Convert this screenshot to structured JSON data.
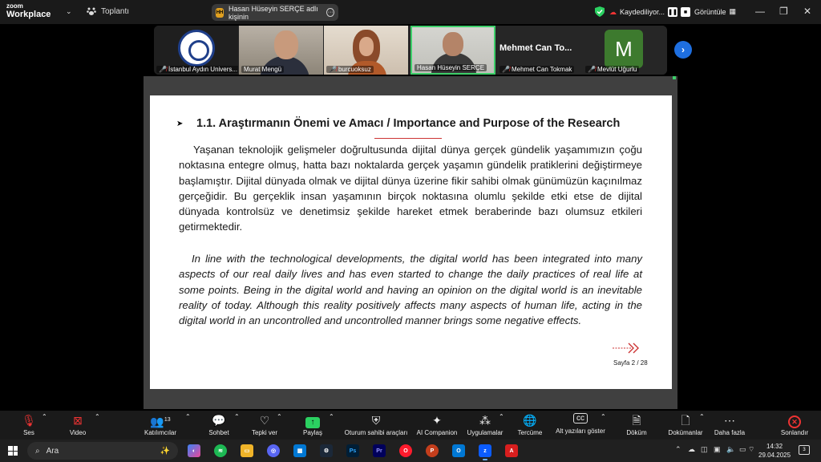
{
  "app": {
    "logo_line1": "zoom",
    "logo_line2": "Workplace",
    "meeting_label": "Toplantı"
  },
  "notification": {
    "avatar": "HH",
    "text": "Hasan Hüseyin SERÇE adlı kişinin"
  },
  "recording": {
    "label": "Kaydediliyor..."
  },
  "view": {
    "label": "Görüntüle"
  },
  "participants": [
    {
      "name": "İstanbul Aydın Univers..."
    },
    {
      "name": "Murat Mengü"
    },
    {
      "name": "burcuoksuz"
    },
    {
      "name": "Hasan Hüseyin SERÇE"
    },
    {
      "name": "Mehmet Can Tokmak",
      "big": "Mehmet Can To..."
    },
    {
      "name": "Mevlüt Uğurlu",
      "initial": "M"
    }
  ],
  "slide": {
    "heading": "1.1. Araştırmanın Önemi ve Amacı / Importance and Purpose of the Research",
    "para_tr": "Yaşanan teknolojik gelişmeler doğrultusunda dijital dünya gerçek gündelik yaşamımızın çoğu noktasına entegre olmuş, hatta bazı noktalarda gerçek yaşamın gündelik pratiklerini değiştirmeye başlamıştır. Dijital dünyada olmak ve dijital dünya üzerine fikir sahibi olmak günümüzün kaçınılmaz gerçeğidir. Bu gerçeklik insan yaşamının birçok noktasına olumlu şekilde etki etse de dijital dünyada kontrolsüz ve denetimsiz şekilde hareket etmek beraberinde bazı olumsuz etkileri getirmektedir.",
    "para_en": "In line with the technological developments, the digital world has been integrated into many aspects of our real daily lives and has even started to change the daily practices of real life at some points. Being in the digital world and having an opinion on the digital world is an inevitable reality of today. Although this reality positively affects many aspects of human life, acting in the digital world in an uncontrolled and uncontrolled manner brings some negative effects.",
    "page": "Sayfa 2 / 28"
  },
  "toolbar": {
    "audio": "Ses",
    "video": "Video",
    "participants": "Katılımcılar",
    "participants_count": "13",
    "chat": "Sohbet",
    "react": "Tepki ver",
    "share": "Paylaş",
    "host_tools": "Oturum sahibi araçları",
    "ai": "AI Companion",
    "apps": "Uygulamalar",
    "translate": "Tercüme",
    "captions": "Alt yazıları göster",
    "transcript": "Döküm",
    "docs": "Dokümanlar",
    "more": "Daha fazla",
    "end": "Sonlandır"
  },
  "taskbar": {
    "search_placeholder": "Ara",
    "time": "14:32",
    "date": "29.04.2025",
    "notif_count": "3"
  },
  "colors": {
    "accent_green": "#2bd161",
    "accent_blue": "#1e6fe0",
    "end_red": "#e33333"
  }
}
